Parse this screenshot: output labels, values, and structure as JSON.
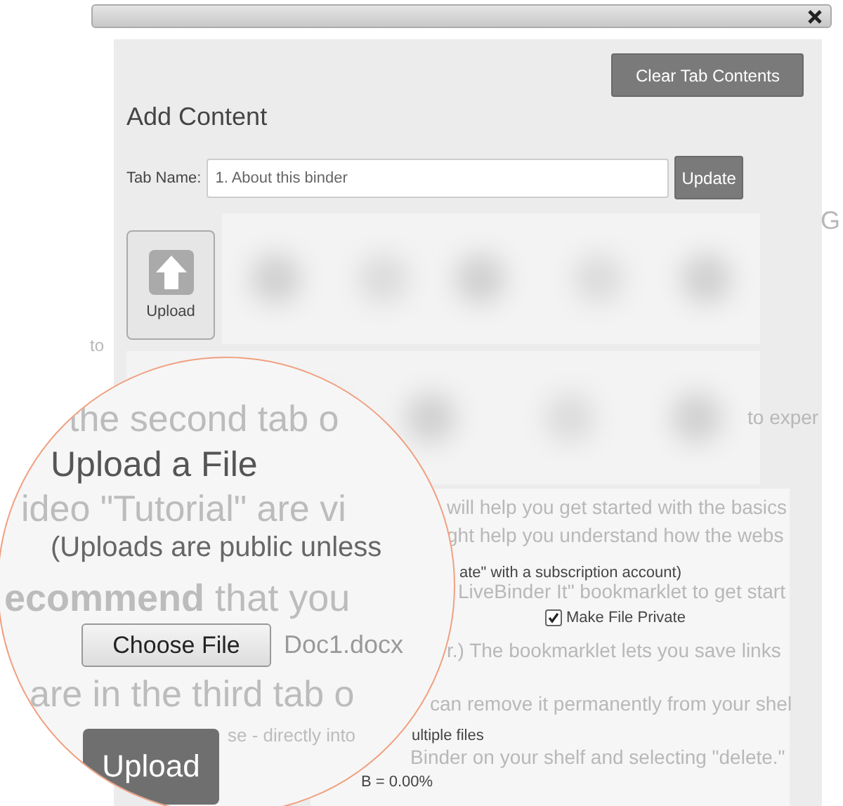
{
  "background_text": [
    {
      "text": "G"
    },
    {
      "text": "to"
    },
    {
      "text": "to exper"
    },
    {
      "text": "will help you get started with the basics"
    },
    {
      "text": "ght help you understand how the webs"
    },
    {
      "text": "LiveBinder It\" bookmarklet to get start"
    },
    {
      "text": "r.)  The bookmarklet lets you save links"
    },
    {
      "text": "can remove it permanently from your shel"
    },
    {
      "text": "Binder on your shelf and selecting \"delete.\""
    }
  ],
  "dialog": {
    "clear_button": "Clear Tab Contents",
    "heading": "Add Content",
    "tab_name": {
      "label": "Tab Name:",
      "value": "1. About this binder"
    },
    "update_button": "Update",
    "upload_tile": {
      "label": "Upload"
    },
    "upload_panel": {
      "note": "ate\" with a subscription account)",
      "private_checkbox": {
        "label": "Make File Private",
        "checked": true
      },
      "multiple": "ultiple files",
      "usage": "B = 0.00%"
    }
  },
  "magnifier": {
    "background_text": [
      {
        "text": "the second tab o"
      },
      {
        "text": "ideo \"Tutorial\" are vi"
      },
      {
        "text": "**ecommend** that you"
      },
      {
        "text": "are in the third tab o"
      },
      {
        "text": "se - directly into"
      }
    ],
    "heading": "Upload a File",
    "note": "(Uploads are public unless",
    "choose_button": "Choose File",
    "file_name": "Doc1.docx",
    "upload_button": "Upload"
  }
}
